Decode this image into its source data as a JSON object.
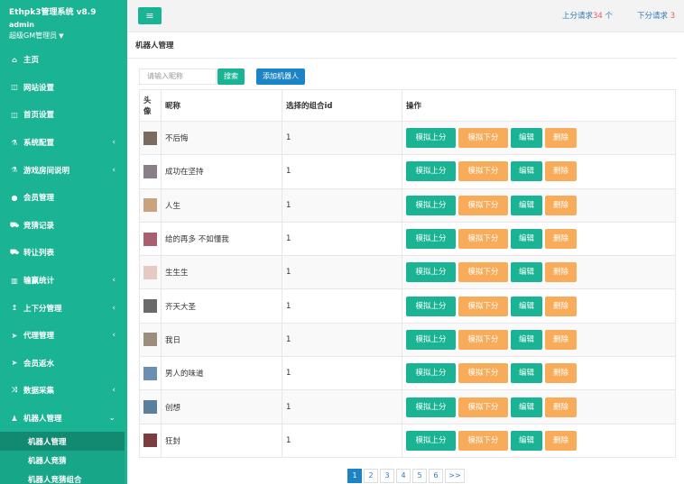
{
  "app": {
    "title": "Ethpk3管理系统 v8.9",
    "user": "admin",
    "role": "超级GM管理员"
  },
  "sidebar": {
    "items": [
      {
        "label": "主页",
        "icon": "home-icon",
        "glyph": "⌂",
        "arrow": ""
      },
      {
        "label": "网站设置",
        "icon": "columns-icon",
        "glyph": "◫",
        "arrow": ""
      },
      {
        "label": "首页设置",
        "icon": "columns-icon",
        "glyph": "◫",
        "arrow": ""
      },
      {
        "label": "系统配置",
        "icon": "flask-icon",
        "glyph": "⚗",
        "arrow": "‹"
      },
      {
        "label": "游戏房间说明",
        "icon": "flask-icon",
        "glyph": "⚗",
        "arrow": "‹"
      },
      {
        "label": "会员管理",
        "icon": "user-icon",
        "glyph": "●",
        "arrow": ""
      },
      {
        "label": "竞猜记录",
        "icon": "car-icon",
        "glyph": "⛟",
        "arrow": ""
      },
      {
        "label": "转让列表",
        "icon": "car-icon",
        "glyph": "⛟",
        "arrow": ""
      },
      {
        "label": "输赢统计",
        "icon": "chart-icon",
        "glyph": "▥",
        "arrow": "‹"
      },
      {
        "label": "上下分管理",
        "icon": "level-up-icon",
        "glyph": "↥",
        "arrow": "‹"
      },
      {
        "label": "代理管理",
        "icon": "send-icon",
        "glyph": "➤",
        "arrow": "‹"
      },
      {
        "label": "会员返水",
        "icon": "send-icon",
        "glyph": "➤",
        "arrow": ""
      },
      {
        "label": "数据采集",
        "icon": "random-icon",
        "glyph": "⤨",
        "arrow": "‹"
      },
      {
        "label": "机器人管理",
        "icon": "male-icon",
        "glyph": "♟",
        "arrow": "⌄"
      }
    ],
    "subitems": [
      {
        "label": "机器人管理",
        "active": true
      },
      {
        "label": "机器人竞猜",
        "active": false
      },
      {
        "label": "机器人竞猜组合",
        "active": false
      }
    ]
  },
  "topbar": {
    "menu_glyph": "≡",
    "up_label": "上分请求",
    "up_count": "34",
    "up_unit": "个",
    "down_label": "下分请求",
    "down_count": "3"
  },
  "panel": {
    "title": "机器人管理",
    "search_placeholder": "请输入昵称",
    "search_button": "搜索",
    "add_button": "添加机器人"
  },
  "table": {
    "headers": [
      "头像",
      "昵称",
      "选择的组合id",
      "操作"
    ],
    "actions": [
      "模拟上分",
      "模拟下分",
      "编辑",
      "删除"
    ],
    "rows": [
      {
        "nickname": "不后悔",
        "combo_id": "1",
        "avatar_color": "#7a6b5e"
      },
      {
        "nickname": "成功在坚持",
        "combo_id": "1",
        "avatar_color": "#8a7f86"
      },
      {
        "nickname": "人生",
        "combo_id": "1",
        "avatar_color": "#c9a27e"
      },
      {
        "nickname": "给的再多 不如懂我",
        "combo_id": "1",
        "avatar_color": "#a8606f"
      },
      {
        "nickname": "生生生",
        "combo_id": "1",
        "avatar_color": "#e7c9c4"
      },
      {
        "nickname": "齐天大圣",
        "combo_id": "1",
        "avatar_color": "#6a6a6a"
      },
      {
        "nickname": "我日",
        "combo_id": "1",
        "avatar_color": "#9c8e7c"
      },
      {
        "nickname": "男人的味道",
        "combo_id": "1",
        "avatar_color": "#6b8fb0"
      },
      {
        "nickname": "创想",
        "combo_id": "1",
        "avatar_color": "#5c7f9c"
      },
      {
        "nickname": "狂封",
        "combo_id": "1",
        "avatar_color": "#7b3d3d"
      }
    ]
  },
  "pagination": {
    "pages": [
      "1",
      "2",
      "3",
      "4",
      "5",
      "6"
    ],
    "current": "1",
    "next": ">>"
  }
}
